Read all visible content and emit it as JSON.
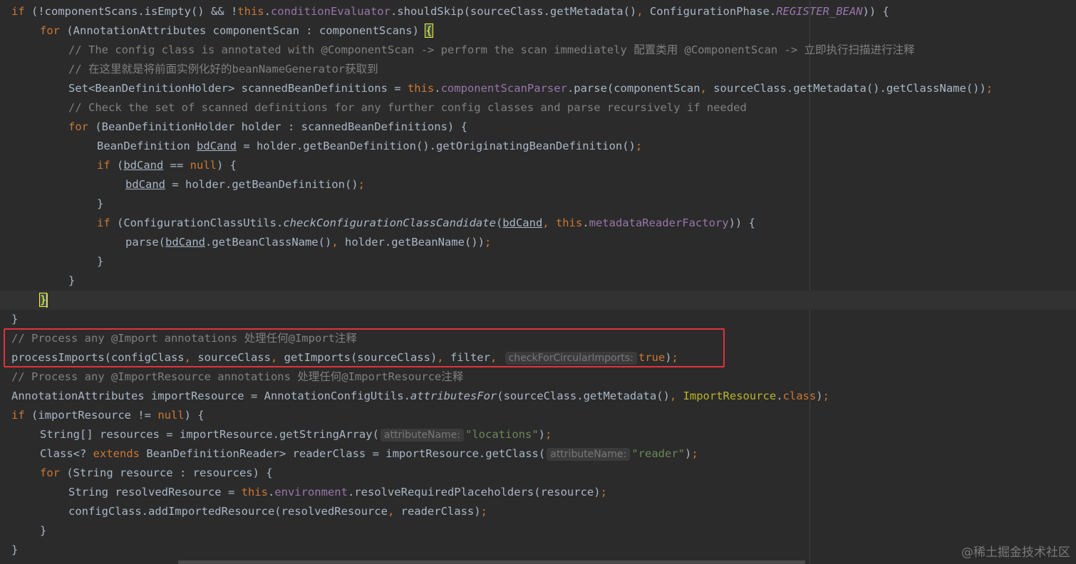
{
  "watermark": "@稀土掘金技术社区",
  "l1": {
    "a": "if",
    "b": " (!componentScans.isEmpty() && !",
    "c": "this",
    "d": ".",
    "e": "conditionEvaluator",
    "f": ".shouldSkip(sourceClass.getMetadata()",
    "g": ", ",
    "h": "ConfigurationPhase.",
    "i": "REGISTER_BEAN",
    "j": ")) {"
  },
  "l2": {
    "a": "for",
    "b": " (AnnotationAttributes componentScan : componentScans) ",
    "c": "{"
  },
  "l3": {
    "a": "// The config class is annotated with @ComponentScan -> perform the scan immediately 配置类用 @ComponentScan -> 立即执行扫描进行注释"
  },
  "l4": {
    "a": "// 在这里就是将前面实例化好的beanNameGenerator获取到"
  },
  "l5": {
    "a": "Set<BeanDefinitionHolder> scannedBeanDefinitions = ",
    "b": "this",
    "c": ".",
    "d": "componentScanParser",
    "e": ".parse(componentScan",
    "f": ", ",
    "g": "sourceClass.getMetadata().getClassName())",
    "h": ";"
  },
  "l6": {
    "a": "// Check the set of scanned definitions for any further config classes and parse recursively if needed"
  },
  "l7": {
    "a": "for",
    "b": " (BeanDefinitionHolder holder : scannedBeanDefinitions) {"
  },
  "l8": {
    "a": "BeanDefinition ",
    "b": "bdCand",
    "c": " = holder.getBeanDefinition().getOriginatingBeanDefinition()",
    "d": ";"
  },
  "l9": {
    "a": "if",
    "b": " (",
    "c": "bdCand",
    "d": " == ",
    "e": "null",
    "f": ") {"
  },
  "l10": {
    "a": "bdCand",
    "b": " = holder.getBeanDefinition()",
    "c": ";"
  },
  "l11": {
    "a": "}"
  },
  "l12": {
    "a": "if",
    "b": " (ConfigurationClassUtils.",
    "c": "checkConfigurationClassCandidate",
    "d": "(",
    "e": "bdCand",
    "f": ", ",
    "g": "this",
    "h": ".",
    "i": "metadataReaderFactory",
    "j": ")) {"
  },
  "l13": {
    "a": "parse(",
    "b": "bdCand",
    "c": ".getBeanClassName()",
    "d": ", ",
    "e": "holder.getBeanName())",
    "f": ";"
  },
  "l14": {
    "a": "}"
  },
  "l15": {
    "a": "}"
  },
  "l16": {
    "a": "}"
  },
  "l17": {
    "a": "}"
  },
  "l18": {
    "a": "// Process any @Import annotations 处理任何@Import注释"
  },
  "l19": {
    "a": "processImports(configClass",
    "b": ", ",
    "c": "sourceClass",
    "d": ", ",
    "e": "getImports(sourceClass)",
    "f": ", ",
    "g": "filter",
    "h": ", ",
    "hint": "checkForCircularImports:",
    "i": "true",
    "j": ")",
    "k": ";"
  },
  "l20": {
    "a": "// Process any @ImportResource annotations 处理任何@ImportResource注释"
  },
  "l21": {
    "a": "AnnotationAttributes importResource = AnnotationConfigUtils.",
    "b": "attributesFor",
    "c": "(sourceClass.getMetadata()",
    "d": ", ",
    "e": "ImportResource",
    "f": ".",
    "g": "class",
    "h": ")",
    "i": ";"
  },
  "l22": {
    "a": "if",
    "b": " (importResource != ",
    "c": "null",
    "d": ") {"
  },
  "l23": {
    "a": "String[] resources = importResource.getStringArray(",
    "hint": "attributeName:",
    "b": "\"locations\"",
    "c": ")",
    "d": ";"
  },
  "l24": {
    "a": "Class<? ",
    "b": "extends",
    "c": " BeanDefinitionReader> readerClass = importResource.getClass(",
    "hint": "attributeName:",
    "d": "\"reader\"",
    "e": ")",
    "f": ";"
  },
  "l25": {
    "a": "for",
    "b": " (String resource : resources) {"
  },
  "l26": {
    "a": "String resolvedResource = ",
    "b": "this",
    "c": ".",
    "d": "environment",
    "e": ".resolveRequiredPlaceholders(resource)",
    "f": ";"
  },
  "l27": {
    "a": "configClass.addImportedResource(resolvedResource",
    "b": ", ",
    "c": "readerClass)",
    "d": ";"
  },
  "l28": {
    "a": "}"
  },
  "l29": {
    "a": "}"
  }
}
